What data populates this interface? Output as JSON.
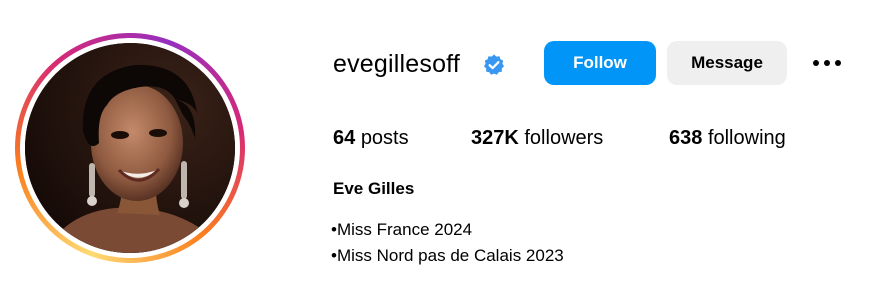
{
  "profile": {
    "username": "evegillesoff",
    "verified_icon": "verified-badge-icon",
    "full_name": "Eve Gilles",
    "bio_lines": [
      "•Miss France 2024",
      "•Miss Nord pas de Calais 2023"
    ]
  },
  "actions": {
    "follow_label": "Follow",
    "message_label": "Message",
    "more_icon": "more-options-icon"
  },
  "stats": {
    "posts_count": "64",
    "posts_label": "posts",
    "followers_count": "327K",
    "followers_label": "followers",
    "following_count": "638",
    "following_label": "following"
  },
  "colors": {
    "follow_button": "#0095f6",
    "message_button": "#efefef",
    "verified_badge": "#3897f0",
    "ring_gradient": [
      "#feda75",
      "#fa7e1e",
      "#d62976",
      "#962fbf"
    ]
  }
}
